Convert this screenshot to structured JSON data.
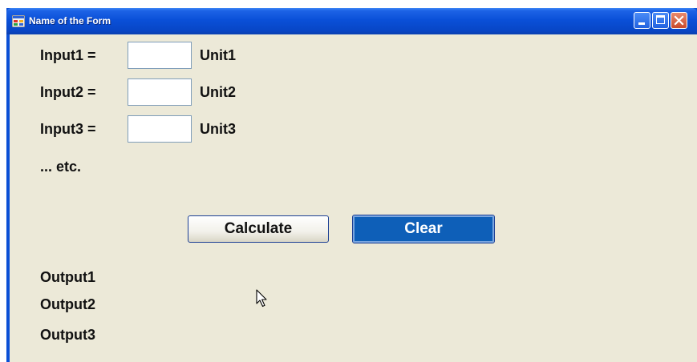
{
  "window": {
    "title": "Name of the Form"
  },
  "form": {
    "rows": [
      {
        "label": "Input1 =",
        "value": "",
        "unit": "Unit1"
      },
      {
        "label": "Input2 =",
        "value": "",
        "unit": "Unit2"
      },
      {
        "label": "Input3 =",
        "value": "",
        "unit": "Unit3"
      }
    ],
    "etc": "... etc.",
    "buttons": {
      "calculate": "Calculate",
      "clear": "Clear"
    },
    "outputs": [
      "Output1",
      "Output2",
      "Output3"
    ]
  },
  "colors": {
    "titlebar": "#0a50d8",
    "client_background": "#ece9d8",
    "focused_button": "#0e5fb8",
    "close_button": "#c94a2a"
  },
  "icons": {
    "app": "form-app-icon",
    "minimize": "minimize-icon",
    "maximize": "maximize-icon",
    "close": "close-icon",
    "cursor": "mouse-pointer-icon"
  }
}
